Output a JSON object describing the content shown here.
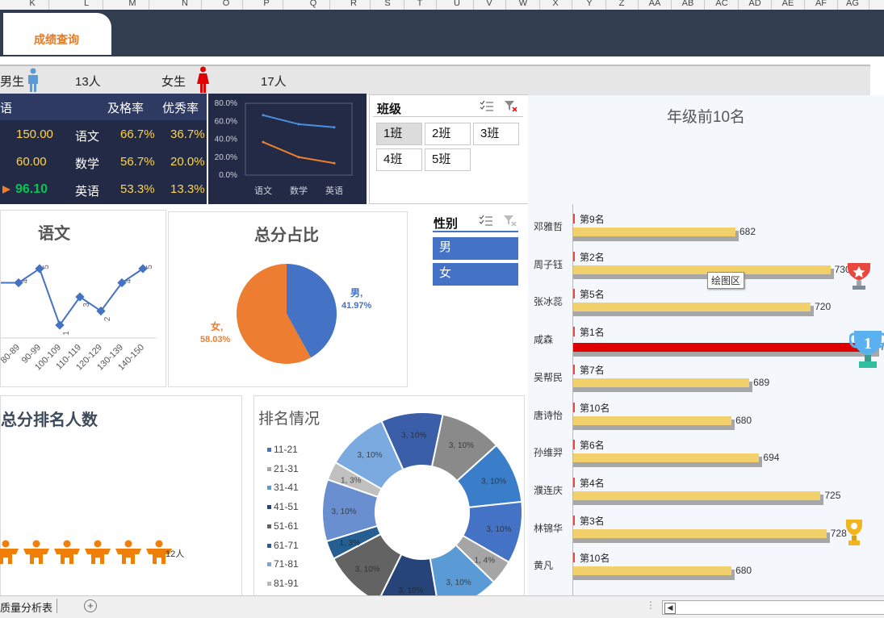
{
  "columns": [
    "K",
    "L",
    "M",
    "N",
    "O",
    "P",
    "Q",
    "R",
    "S",
    "T",
    "U",
    "V",
    "W",
    "X",
    "Y",
    "Z",
    "AA",
    "AB",
    "AC",
    "AD",
    "AE",
    "AF",
    "AG"
  ],
  "sheet_tab": "成绩查询",
  "gender_bar": {
    "male_label": "男生",
    "male_count": "13人",
    "female_label": "女生",
    "female_count": "17人"
  },
  "score_table": {
    "header": [
      "语",
      "及格率",
      "优秀率"
    ],
    "rows": [
      {
        "score": "150.00",
        "subject": "语文",
        "pass": "66.7%",
        "excellent": "36.7%"
      },
      {
        "score": "60.00",
        "subject": "数学",
        "pass": "56.7%",
        "excellent": "20.0%"
      },
      {
        "score": "96.10",
        "subject": "英语",
        "pass": "53.3%",
        "excellent": "13.3%"
      }
    ]
  },
  "mini_chart": {
    "type": "line",
    "categories": [
      "语文",
      "数学",
      "英语"
    ],
    "y_ticks": [
      "80.0%",
      "60.0%",
      "40.0%",
      "20.0%",
      "0.0%"
    ],
    "ylim": [
      0,
      80
    ],
    "series": [
      {
        "color": "#4a90e2",
        "values": [
          66.7,
          56.7,
          53.3
        ]
      },
      {
        "color": "#f07f2a",
        "values": [
          36.7,
          20.0,
          13.3
        ]
      }
    ]
  },
  "class_slicer": {
    "title": "班级",
    "options": [
      "1班",
      "2班",
      "3班",
      "4班",
      "5班"
    ],
    "selected": "1班"
  },
  "gender_slicer": {
    "title": "性别",
    "options": [
      "男",
      "女"
    ]
  },
  "chinese_chart": {
    "title": "语文",
    "type": "line",
    "categories": [
      "80-89",
      "90-99",
      "100-109",
      "110-119",
      "120-129",
      "130-139",
      "140-150"
    ],
    "values": [
      4,
      5,
      1,
      3,
      2,
      4,
      5
    ],
    "color": "#4472c4"
  },
  "pie_chart": {
    "title": "总分占比",
    "type": "pie",
    "slices": [
      {
        "label": "男,",
        "pct": "41.97%",
        "value": 41.97,
        "color": "#4472c4"
      },
      {
        "label": "女,",
        "pct": "58.03%",
        "value": 58.03,
        "color": "#ed7d31"
      }
    ]
  },
  "rank_people": {
    "title": "总分排名人数",
    "count": "12人",
    "icons": 6
  },
  "donut_chart": {
    "title": "排名情况",
    "type": "pie",
    "legend": [
      "11-21",
      "21-31",
      "31-41",
      "41-51",
      "51-61",
      "61-71",
      "71-81",
      "81-91"
    ],
    "legend_colors": [
      "#4472c4",
      "#a5a5a5",
      "#5b9bd5",
      "#264478",
      "#636363",
      "#255e91",
      "#7aa7da",
      "#b7b7b7"
    ],
    "segments": [
      {
        "label": "3, 10%",
        "color": "#3a5fa8",
        "value": 10
      },
      {
        "label": "3, 10%",
        "color": "#8a8a8a",
        "value": 10
      },
      {
        "label": "3, 10%",
        "color": "#3a7dc9",
        "value": 10
      },
      {
        "label": "3, 10%",
        "color": "#4472c4",
        "value": 10
      },
      {
        "label": "1, 4%",
        "color": "#a5a5a5",
        "value": 4
      },
      {
        "label": "3, 10%",
        "color": "#5b9bd5",
        "value": 10
      },
      {
        "label": "3, 10%",
        "color": "#264478",
        "value": 10
      },
      {
        "label": "3, 10%",
        "color": "#636363",
        "value": 10
      },
      {
        "label": "1, 3%",
        "color": "#255e91",
        "value": 3
      },
      {
        "label": "3, 10%",
        "color": "#6a8fd0",
        "value": 10
      },
      {
        "label": "1, 3%",
        "color": "#c0c0c0",
        "value": 3
      },
      {
        "label": "3, 10%",
        "color": "#7aaae0",
        "value": 10
      }
    ]
  },
  "top10": {
    "title": "年级前10名",
    "tooltip": "绘图区",
    "items": [
      {
        "name": "邓雅哲",
        "rank": "第9名",
        "score": 682,
        "highlight": false
      },
      {
        "name": "周子钰",
        "rank": "第2名",
        "score": 730,
        "highlight": false
      },
      {
        "name": "张冰蕊",
        "rank": "第5名",
        "score": 720,
        "highlight": false
      },
      {
        "name": "咸森",
        "rank": "第1名",
        "score": 753,
        "highlight": true
      },
      {
        "name": "吴帮民",
        "rank": "第7名",
        "score": 689,
        "highlight": false
      },
      {
        "name": "唐诗怡",
        "rank": "第10名",
        "score": 680,
        "highlight": false
      },
      {
        "name": "孙维羿",
        "rank": "第6名",
        "score": 694,
        "highlight": false
      },
      {
        "name": "濮连庆",
        "rank": "第4名",
        "score": 725,
        "highlight": false
      },
      {
        "name": "林锦华",
        "rank": "第3名",
        "score": 728,
        "highlight": false
      },
      {
        "name": "黄凡",
        "rank": "第10名",
        "score": 680,
        "highlight": false
      }
    ],
    "trophy_first": "1"
  },
  "bottom": {
    "sheet": "质量分析表",
    "add": "+"
  }
}
